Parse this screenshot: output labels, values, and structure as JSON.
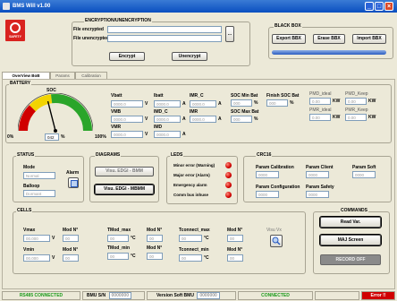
{
  "window": {
    "title": "BMS Will v1.00"
  },
  "logo": {
    "text": "SAFETY"
  },
  "encryption": {
    "title": "ENCRYPTION/UNENCRYPTION",
    "file_encrypted_label": "File encrypted",
    "file_unencrypted_label": "File unencrypted",
    "encrypt_label": "Encrypt",
    "unencrypt_label": "Unencrypt",
    "browse_label": "..."
  },
  "blackbox": {
    "title": "BLACK BOX",
    "export_label": "Export BBX",
    "erase_label": "Erase BBX",
    "import_label": "Import BBX"
  },
  "tabs": [
    {
      "label": "OverView BoB"
    },
    {
      "label": "Params"
    },
    {
      "label": "Calibration"
    }
  ],
  "battery": {
    "title": "BATTERY",
    "soc_label": "SOC",
    "gauge_min": "0%",
    "gauge_max": "100%",
    "gauge_value": "042",
    "gauge_unit": "%",
    "gauge_fraction": 0.42,
    "vbatt": {
      "label": "Vbatt",
      "value": "0000.0",
      "unit": "V"
    },
    "vmb": {
      "label": "VMB",
      "value": "0000.0",
      "unit": "V"
    },
    "vmr": {
      "label": "VMR",
      "value": "0000.0",
      "unit": "V"
    },
    "ibatt": {
      "label": "Ibatt",
      "value": "0000.0",
      "unit": "A"
    },
    "imr_c": {
      "label": "IMR_C",
      "value": "0000.0",
      "unit": "A"
    },
    "imd_c": {
      "label": "IMD_C",
      "value": "0000.0",
      "unit": "A"
    },
    "imr": {
      "label": "IMR",
      "value": "0000.0",
      "unit": "A"
    },
    "imd": {
      "label": "IMD",
      "value": "0000.0",
      "unit": "A"
    },
    "soc_min_bat": {
      "label": "SOC Min Bat",
      "value": "000",
      "unit": "%"
    },
    "finish_soc_bat": {
      "label": "Finish SOC Bat",
      "value": "000",
      "unit": "%"
    },
    "soc_max_bat": {
      "label": "SOC Max Bat",
      "value": "000",
      "unit": "%"
    },
    "pmd_ideal": {
      "label": "PMD_ideal",
      "value": "0.00",
      "unit": "KW"
    },
    "pmd_keep": {
      "label": "PMD_Keep",
      "value": "0.00",
      "unit": "KW"
    },
    "pmr_ideal": {
      "label": "PMR_ideal",
      "value": "0.00",
      "unit": "KW"
    },
    "pmr_keep": {
      "label": "PMR_Keep",
      "value": "0.00",
      "unit": "KW"
    }
  },
  "status": {
    "title": "STATUS",
    "mode_label": "Mode",
    "mode_value": "Normal",
    "balloop_label": "Balloop",
    "balloop_value": "Dormant",
    "alarm_label": "Alarm"
  },
  "diagrams": {
    "title": "DIAGRAMS",
    "btn1_label": "Visu. EDGI - BMM",
    "btn2_label": "Visu. EDGI - MBMM"
  },
  "leds": {
    "title": "LEDS",
    "items": [
      {
        "label": "Minor error (Warning)"
      },
      {
        "label": "Major error (Alarm)"
      },
      {
        "label": "Emergency alarm"
      },
      {
        "label": "Comm bus inhuse"
      }
    ],
    "color": "#d00000"
  },
  "crc16": {
    "title": "CRC16",
    "param_calibration": {
      "label": "Param Calibration",
      "value": "0000"
    },
    "param_client": {
      "label": "Param Client",
      "value": "0000"
    },
    "param_soft": {
      "label": "Param Soft",
      "value": "0000"
    },
    "param_configuration": {
      "label": "Param Configuration",
      "value": "0000"
    },
    "param_safety": {
      "label": "Param Safety",
      "value": "0000"
    }
  },
  "cells": {
    "title": "CELLS",
    "vmax": {
      "label": "Vmax",
      "value": "00.000",
      "unit": "V"
    },
    "vmin": {
      "label": "Vmin",
      "value": "00.000",
      "unit": "V"
    },
    "modn1_label": "Mod N°",
    "modn1_value": "00",
    "modn2_value": "00",
    "tmod_max": {
      "label": "TMod_max",
      "value": "00",
      "unit": "°C"
    },
    "tmod_min": {
      "label": "TMod_min",
      "value": "00",
      "unit": "°C"
    },
    "tconnect_max": {
      "label": "Tconnect_max",
      "value": "00",
      "unit": "°C"
    },
    "tconnect_min": {
      "label": "Tconnect_min",
      "value": "00",
      "unit": "°C"
    },
    "modn_values": [
      "00",
      "00",
      "00",
      "00"
    ],
    "visu_label": "Visu Vx"
  },
  "commands": {
    "title": "COMMANDS",
    "read_label": "Read Var.",
    "maj_label": "MAJ Screen",
    "record_label": "RECORD OFF"
  },
  "statusbar": {
    "rs485": "RS485 CONNECTED",
    "bmu_sn_label": "BMU S/N",
    "bmu_sn_value": "0000000",
    "version_label": "Version Soft BMU",
    "version_value": "0000000",
    "connected": "CONNECTED",
    "error": "Error !!",
    "green": "#1a9a1a",
    "red": "#d00000"
  }
}
